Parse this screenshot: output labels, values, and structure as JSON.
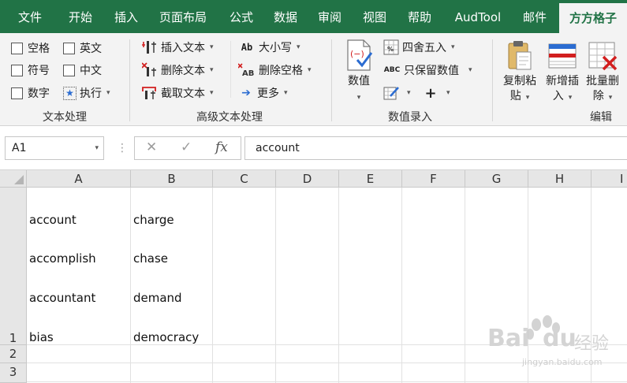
{
  "tabs": [
    "文件",
    "开始",
    "插入",
    "页面布局",
    "公式",
    "数据",
    "审阅",
    "视图",
    "帮助",
    "AudTool",
    "邮件",
    "方方格子"
  ],
  "active_tab_index": 11,
  "ribbon": {
    "text_processing": {
      "label": "文本处理",
      "checkboxes": [
        "空格",
        "英文",
        "符号",
        "中文",
        "数字"
      ],
      "execute": "执行"
    },
    "advanced_text": {
      "label": "高级文本处理",
      "items": [
        "插入文本",
        "删除文本",
        "截取文本",
        "大小写",
        "删除空格",
        "更多"
      ]
    },
    "value_entry": {
      "label": "数值录入",
      "value_button": "数值",
      "round": "四舍五入",
      "keep_value": "只保留数值"
    },
    "edit": {
      "label": "编辑",
      "copy_paste": [
        "复制粘",
        "贴"
      ],
      "add_insert": [
        "新增插",
        "入"
      ],
      "batch_delete": [
        "批量删",
        "除"
      ]
    }
  },
  "formula_bar": {
    "name_box": "A1",
    "cancel": "✕",
    "confirm": "✓",
    "fx": "fx",
    "content": "account"
  },
  "grid": {
    "columns": [
      "A",
      "B",
      "C",
      "D",
      "E",
      "F",
      "G",
      "H",
      "I"
    ],
    "rows": [
      "1",
      "2",
      "3"
    ],
    "cells": {
      "A1": [
        "account",
        "accomplish",
        "accountant",
        "bias"
      ],
      "B1": [
        "charge",
        "chase",
        "demand",
        "democracy"
      ]
    }
  },
  "watermark": {
    "brand": "Bai",
    "brand2": "du",
    "suffix": "经验",
    "url": "jingyan.baidu.com"
  },
  "colors": {
    "tab_bar": "#217346",
    "ribbon_bg": "#f3f3f3",
    "header_bg": "#e6e6e6"
  }
}
